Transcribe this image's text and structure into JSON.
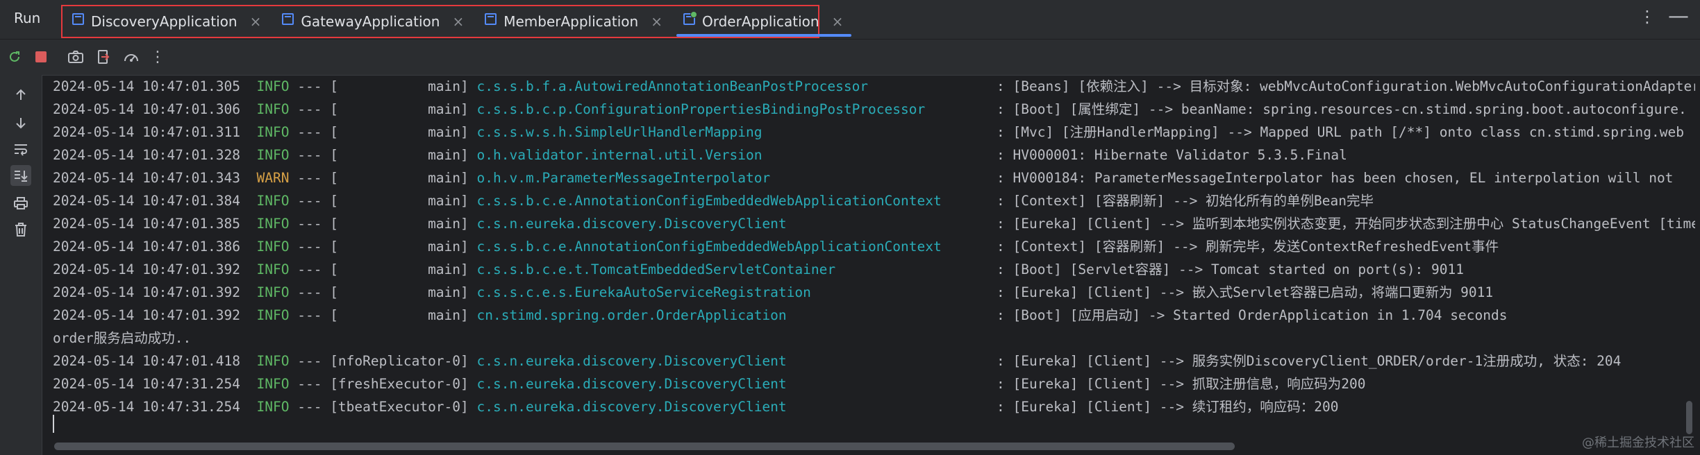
{
  "run_panel": {
    "title": "Run",
    "tabs": [
      {
        "label": "DiscoveryApplication",
        "active": false
      },
      {
        "label": "GatewayApplication",
        "active": false
      },
      {
        "label": "MemberApplication",
        "active": false
      },
      {
        "label": "OrderApplication",
        "active": true
      }
    ],
    "tab_close_glyph": "×",
    "more_glyph": "⋮",
    "minimize_glyph": "—"
  },
  "toolbar": {
    "buttons": [
      "rerun-icon",
      "stop-icon",
      "camera-icon",
      "exit-icon",
      "speedometer-icon",
      "more-icon"
    ],
    "more_glyph": "⋮"
  },
  "gutter": {
    "buttons": [
      "arrow-up-icon",
      "arrow-down-icon",
      "soft-wrap-icon",
      "scroll-to-end-icon",
      "print-icon",
      "trash-icon"
    ]
  },
  "console": {
    "lines": [
      {
        "ts": "2024-05-14 10:47:01.305",
        "level": "INFO",
        "sep": " --- ",
        "thread": "[           main]",
        "cls": "c.s.s.b.f.a.AutowiredAnnotationBeanPostProcessor",
        "msg": ": [Beans] [依赖注入] --> 目标对象: webMvcAutoConfiguration.WebMvcAutoConfigurationAdapter"
      },
      {
        "ts": "2024-05-14 10:47:01.306",
        "level": "INFO",
        "sep": " --- ",
        "thread": "[           main]",
        "cls": "c.s.s.b.c.p.ConfigurationPropertiesBindingPostProcessor",
        "msg": ": [Boot] [属性绑定] --> beanName: spring.resources-cn.stimd.spring.boot.autoconfigure."
      },
      {
        "ts": "2024-05-14 10:47:01.311",
        "level": "INFO",
        "sep": " --- ",
        "thread": "[           main]",
        "cls": "c.s.s.w.s.h.SimpleUrlHandlerMapping",
        "msg": ": [Mvc] [注册HandlerMapping] --> Mapped URL path [/**] onto class cn.stimd.spring.web"
      },
      {
        "ts": "2024-05-14 10:47:01.328",
        "level": "INFO",
        "sep": " --- ",
        "thread": "[           main]",
        "cls": "o.h.validator.internal.util.Version",
        "msg": ": HV000001: Hibernate Validator 5.3.5.Final"
      },
      {
        "ts": "2024-05-14 10:47:01.343",
        "level": "WARN",
        "sep": " --- ",
        "thread": "[           main]",
        "cls": "o.h.v.m.ParameterMessageInterpolator",
        "msg": ": HV000184: ParameterMessageInterpolator has been chosen, EL interpolation will not"
      },
      {
        "ts": "2024-05-14 10:47:01.384",
        "level": "INFO",
        "sep": " --- ",
        "thread": "[           main]",
        "cls": "c.s.s.b.c.e.AnnotationConfigEmbeddedWebApplicationContext",
        "msg": ": [Context] [容器刷新] --> 初始化所有的单例Bean完毕"
      },
      {
        "ts": "2024-05-14 10:47:01.385",
        "level": "INFO",
        "sep": " --- ",
        "thread": "[           main]",
        "cls": "c.s.n.eureka.discovery.DiscoveryClient",
        "msg": ": [Eureka] [Client] --> 监听到本地实例状态变更，开始同步状态到注册中心 StatusChangeEvent [time"
      },
      {
        "ts": "2024-05-14 10:47:01.386",
        "level": "INFO",
        "sep": " --- ",
        "thread": "[           main]",
        "cls": "c.s.s.b.c.e.AnnotationConfigEmbeddedWebApplicationContext",
        "msg": ": [Context] [容器刷新] --> 刷新完毕，发送ContextRefreshedEvent事件"
      },
      {
        "ts": "2024-05-14 10:47:01.392",
        "level": "INFO",
        "sep": " --- ",
        "thread": "[           main]",
        "cls": "c.s.s.b.c.e.t.TomcatEmbeddedServletContainer",
        "msg": ": [Boot] [Servlet容器] --> Tomcat started on port(s): 9011"
      },
      {
        "ts": "2024-05-14 10:47:01.392",
        "level": "INFO",
        "sep": " --- ",
        "thread": "[           main]",
        "cls": "c.s.s.c.e.s.EurekaAutoServiceRegistration",
        "msg": ": [Eureka] [Client] --> 嵌入式Servlet容器已启动，将端口更新为 9011"
      },
      {
        "ts": "2024-05-14 10:47:01.392",
        "level": "INFO",
        "sep": " --- ",
        "thread": "[           main]",
        "cls": "cn.stimd.spring.order.OrderApplication",
        "msg": ": [Boot] [应用启动] -> Started OrderApplication in 1.704 seconds"
      },
      {
        "plain": "order服务启动成功.."
      },
      {
        "ts": "2024-05-14 10:47:01.418",
        "level": "INFO",
        "sep": " --- ",
        "thread": "[nfoReplicator-0]",
        "cls": "c.s.n.eureka.discovery.DiscoveryClient",
        "msg": ": [Eureka] [Client] --> 服务实例DiscoveryClient_ORDER/order-1注册成功, 状态: 204"
      },
      {
        "ts": "2024-05-14 10:47:31.254",
        "level": "INFO",
        "sep": " --- ",
        "thread": "[freshExecutor-0]",
        "cls": "c.s.n.eureka.discovery.DiscoveryClient",
        "msg": ": [Eureka] [Client] --> 抓取注册信息，响应码为200"
      },
      {
        "ts": "2024-05-14 10:47:31.254",
        "level": "INFO",
        "sep": " --- ",
        "thread": "[tbeatExecutor-0]",
        "cls": "c.s.n.eureka.discovery.DiscoveryClient",
        "msg": ": [Eureka] [Client] --> 续订租约，响应码：200"
      }
    ]
  },
  "watermark": "@稀土掘金技术社区",
  "colors": {
    "background": "#1e1f22",
    "panel": "#2b2d30",
    "info": "#5fb865",
    "warn": "#d6a046",
    "logger": "#2aacb8",
    "tab_highlight_border": "#e5393d",
    "active_tab_underline": "#548af7"
  }
}
